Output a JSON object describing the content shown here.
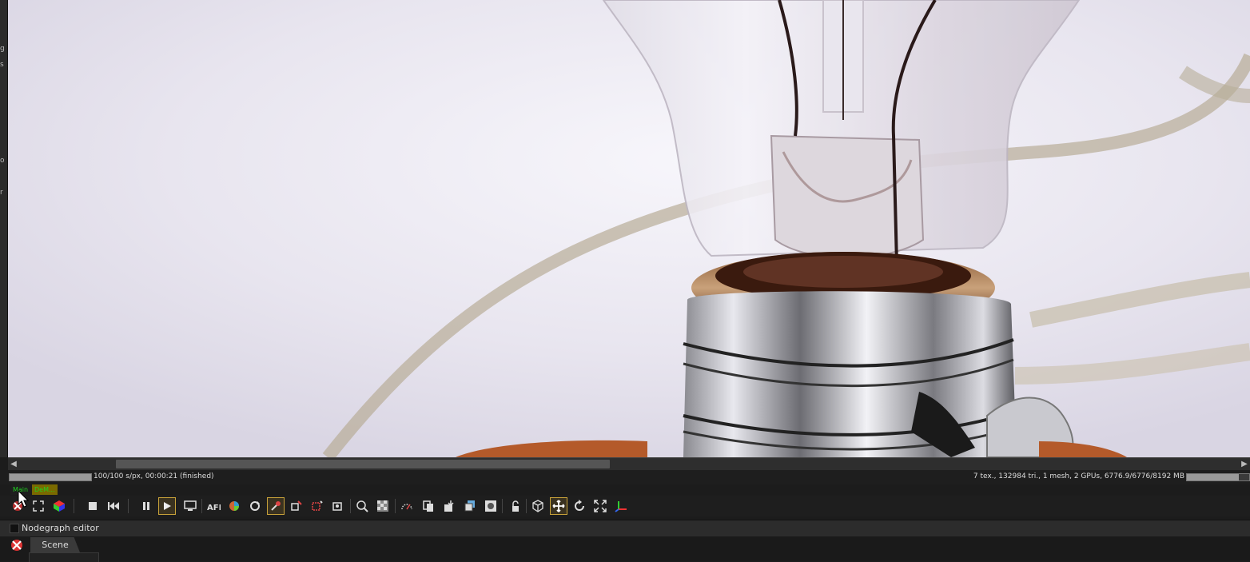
{
  "sidebar": {
    "fragments": [
      "g",
      "s",
      "o",
      "r"
    ]
  },
  "viewport": {
    "subject": "light-bulb-render"
  },
  "statusbar": {
    "render_progress": 1.0,
    "render_status": "100/100 s/px, 00:00:21 (finished)",
    "scene_stats": "7 tex., 132984 tri., 1 mesh, 2 GPUs, 6776.9/6776/8192 MB",
    "memory_fraction": 0.83
  },
  "mini_tabs": [
    {
      "label": "Main",
      "color": "#1fd21f"
    },
    {
      "label": "DeM...",
      "color": "#1fd21f",
      "bg": "#7a6a00"
    }
  ],
  "toolbar": {
    "icons": [
      "render-region-icon",
      "zoom-fit-icon",
      "cube-color-icon",
      "stop-icon",
      "restart-icon",
      "pause-icon",
      "play-icon",
      "screen-icon",
      "afi-icon",
      "color-wheel-icon",
      "reload-icon",
      "material-picker-icon",
      "object-picker-icon",
      "region-picker-icon",
      "focus-picker-icon",
      "zoom-tool-icon",
      "checker-icon",
      "exposure-dial-icon",
      "copy-icon",
      "save-icon",
      "layers-icon",
      "clay-icon",
      "lock-icon",
      "cube-view-icon",
      "move-icon",
      "rotate-icon",
      "fullscreen-icon",
      "axis-gizmo-icon"
    ]
  },
  "panel": {
    "title": "Nodegraph editor"
  },
  "scene_tab": {
    "label": "Scene"
  },
  "colors": {
    "accent": "#c8a23a",
    "status_green": "#1fd21f"
  }
}
